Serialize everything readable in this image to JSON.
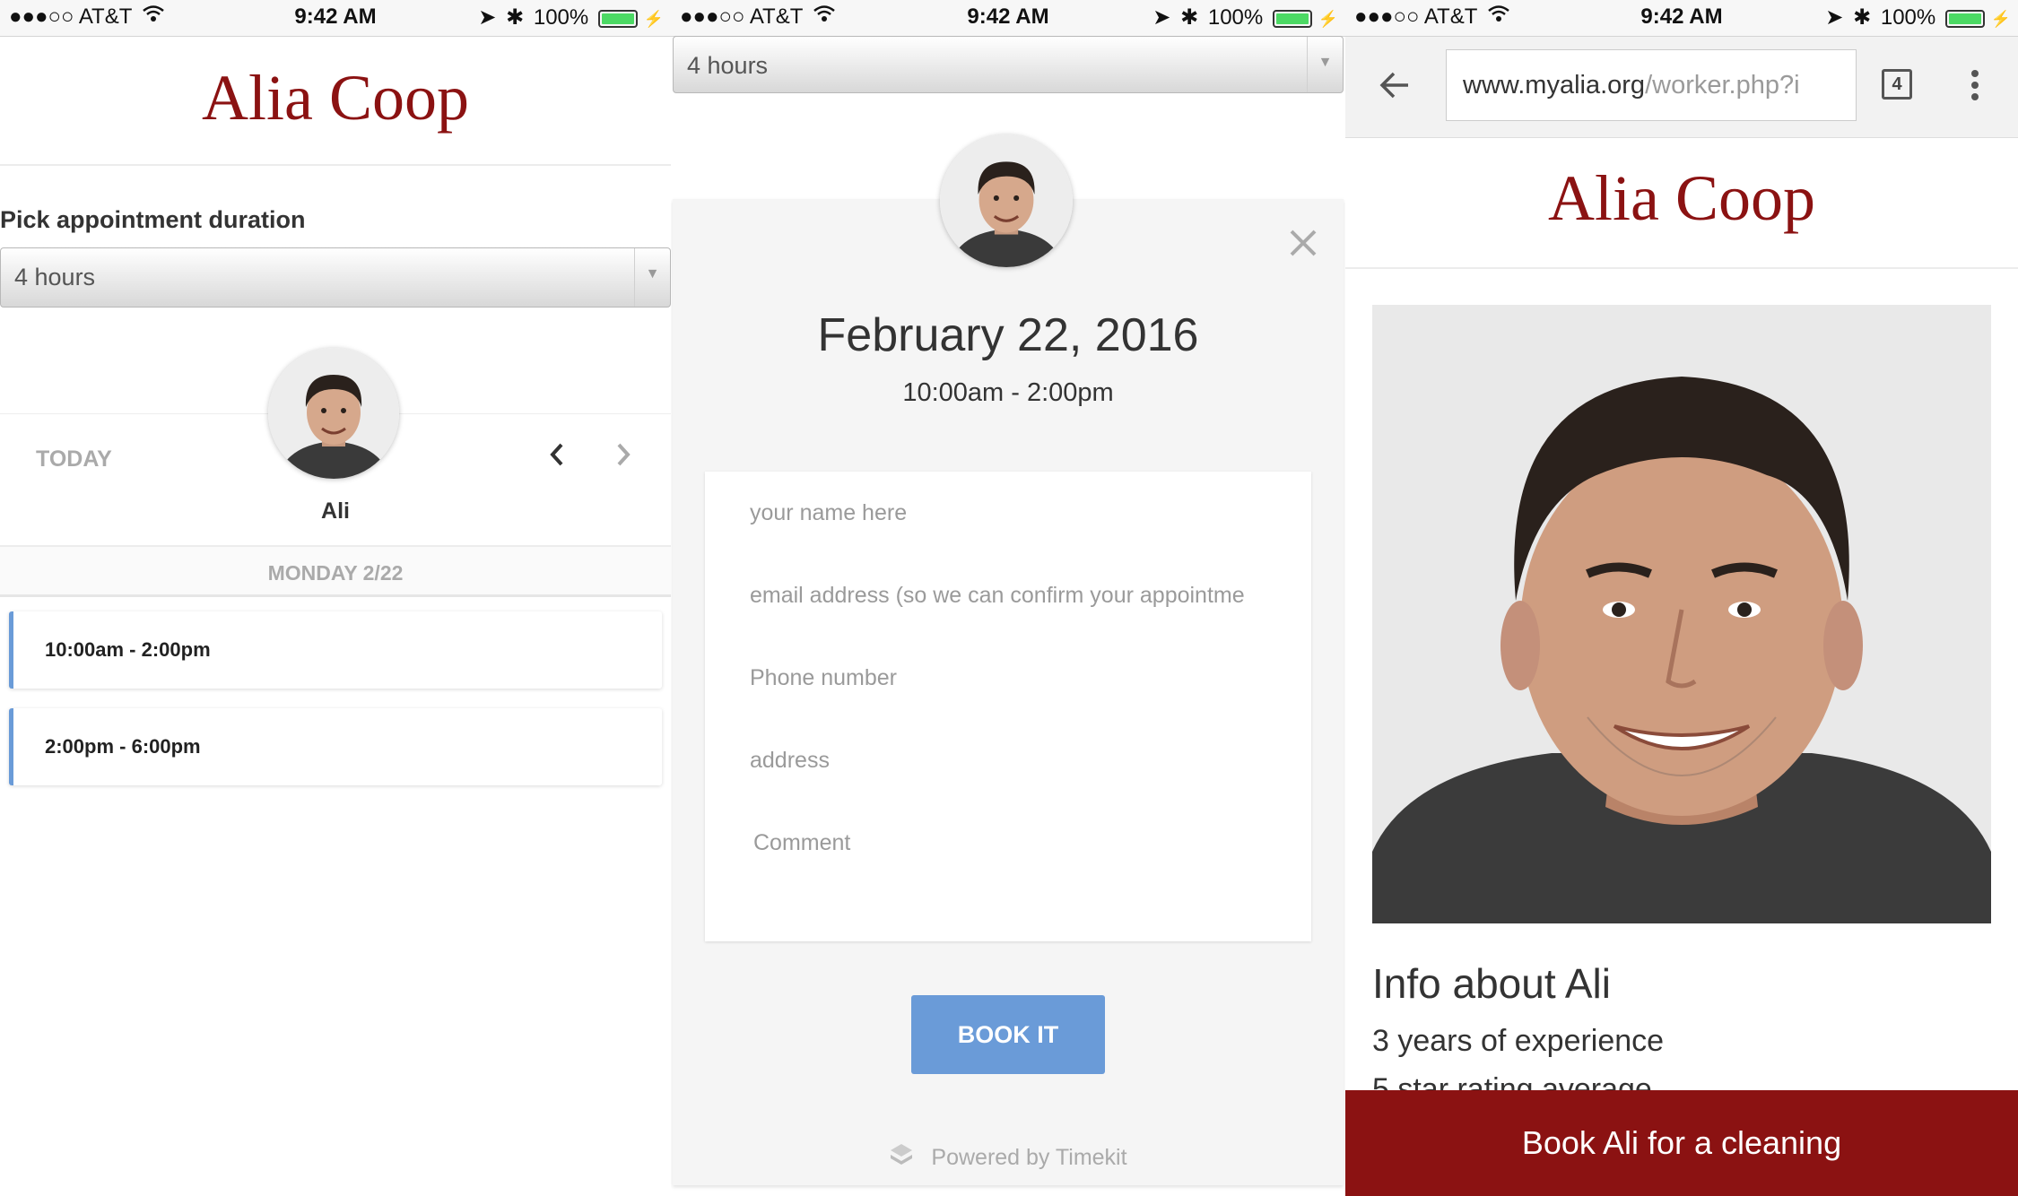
{
  "status_bar": {
    "carrier": "●●●○○ AT&T",
    "time": "9:42 AM",
    "battery": "100%"
  },
  "panel1": {
    "brand": "Alia Coop",
    "duration_label": "Pick appointment duration",
    "duration_value": "4 hours",
    "today": "TODAY",
    "worker_name": "Ali",
    "day_header": "MONDAY 2/22",
    "slots": [
      "10:00am - 2:00pm",
      "2:00pm - 6:00pm"
    ]
  },
  "panel2": {
    "duration_value": "4 hours",
    "date": "February 22, 2016",
    "time_range": "10:00am - 2:00pm",
    "fields": {
      "name": "your name here",
      "email": "email address (so we can confirm your appointme",
      "phone": "Phone number",
      "address": "address",
      "comment": "Comment"
    },
    "book_button": "BOOK IT",
    "powered_by": "Powered by Timekit"
  },
  "panel3": {
    "url_domain": "www.myalia.org",
    "url_path": "/worker.php?i",
    "tab_count": "4",
    "brand": "Alia Coop",
    "info_title": "Info about Ali",
    "info_lines": [
      "3 years of experience",
      "5 star rating average"
    ],
    "cta": "Book Ali for a cleaning"
  },
  "colors": {
    "brand_red": "#8b1212",
    "accent_blue": "#6a9bd8",
    "cta_red": "#8b1212"
  }
}
